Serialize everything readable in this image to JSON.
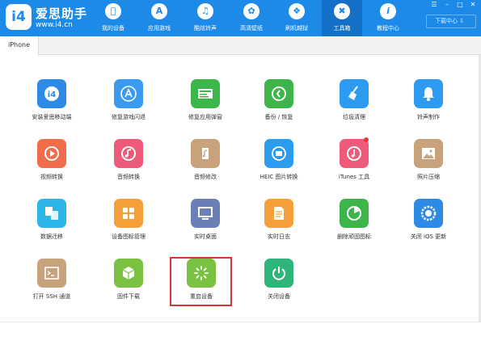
{
  "app": {
    "logo_text": "i4",
    "name": "爱思助手",
    "url": "www.i4.cn"
  },
  "nav": [
    {
      "label": "我的设备",
      "icon": "apple-icon"
    },
    {
      "label": "应用游戏",
      "icon": "app-store-icon"
    },
    {
      "label": "酷炫铃声",
      "icon": "bell-icon"
    },
    {
      "label": "高清壁纸",
      "icon": "flower-icon"
    },
    {
      "label": "刷机越狱",
      "icon": "dropbox-icon"
    },
    {
      "label": "工具箱",
      "icon": "tools-icon"
    },
    {
      "label": "教程中心",
      "icon": "info-icon"
    }
  ],
  "header": {
    "download_center": "下载中心 ⇩"
  },
  "tabs": [
    {
      "label": "iPhone"
    }
  ],
  "tools": [
    {
      "label": "安装爱思移动端",
      "icon": "i4-mobile-icon",
      "color": "#2d8be6"
    },
    {
      "label": "修复游戏闪退",
      "icon": "app-fix-icon",
      "color": "#3a9af0"
    },
    {
      "label": "修复应用弹窗",
      "icon": "app-id-icon",
      "color": "#3cb54a"
    },
    {
      "label": "备份 / 恢复",
      "icon": "backup-restore-icon",
      "color": "#3cb54a"
    },
    {
      "label": "垃圾清理",
      "icon": "broom-icon",
      "color": "#2d9cf0"
    },
    {
      "label": "铃声制作",
      "icon": "bell-make-icon",
      "color": "#2d9cf0"
    },
    {
      "label": "视频转换",
      "icon": "video-convert-icon",
      "color": "#f06c4a"
    },
    {
      "label": "音频转换",
      "icon": "audio-convert-icon",
      "color": "#ee5a7a"
    },
    {
      "label": "音频修改",
      "icon": "audio-edit-icon",
      "color": "#c7a27a"
    },
    {
      "label": "HEIC 图片转换",
      "icon": "heic-convert-icon",
      "color": "#2d9cf0"
    },
    {
      "label": "iTunes 工具",
      "icon": "itunes-icon",
      "color": "#ee5a7a"
    },
    {
      "label": "照片压缩",
      "icon": "photo-compress-icon",
      "color": "#c7a27a"
    },
    {
      "label": "数据迁移",
      "icon": "data-migrate-icon",
      "color": "#2db5e8"
    },
    {
      "label": "设备图标管理",
      "icon": "icon-manage-icon",
      "color": "#f5a03a"
    },
    {
      "label": "实时桌面",
      "icon": "live-desktop-icon",
      "color": "#6a7fb5"
    },
    {
      "label": "实时日志",
      "icon": "live-log-icon",
      "color": "#f5a03a"
    },
    {
      "label": "删除顽固图标",
      "icon": "delete-icon-icon",
      "color": "#3cb54a"
    },
    {
      "label": "关闭 iOS 更新",
      "icon": "ios-update-off-icon",
      "color": "#2d8be6"
    },
    {
      "label": "打开 SSH 通道",
      "icon": "ssh-terminal-icon",
      "color": "#c7a27a"
    },
    {
      "label": "固件下载",
      "icon": "firmware-box-icon",
      "color": "#7bc142"
    },
    {
      "label": "重启设备",
      "icon": "restart-icon",
      "color": "#7bc142"
    },
    {
      "label": "关闭设备",
      "icon": "power-off-icon",
      "color": "#2fb57a"
    }
  ]
}
